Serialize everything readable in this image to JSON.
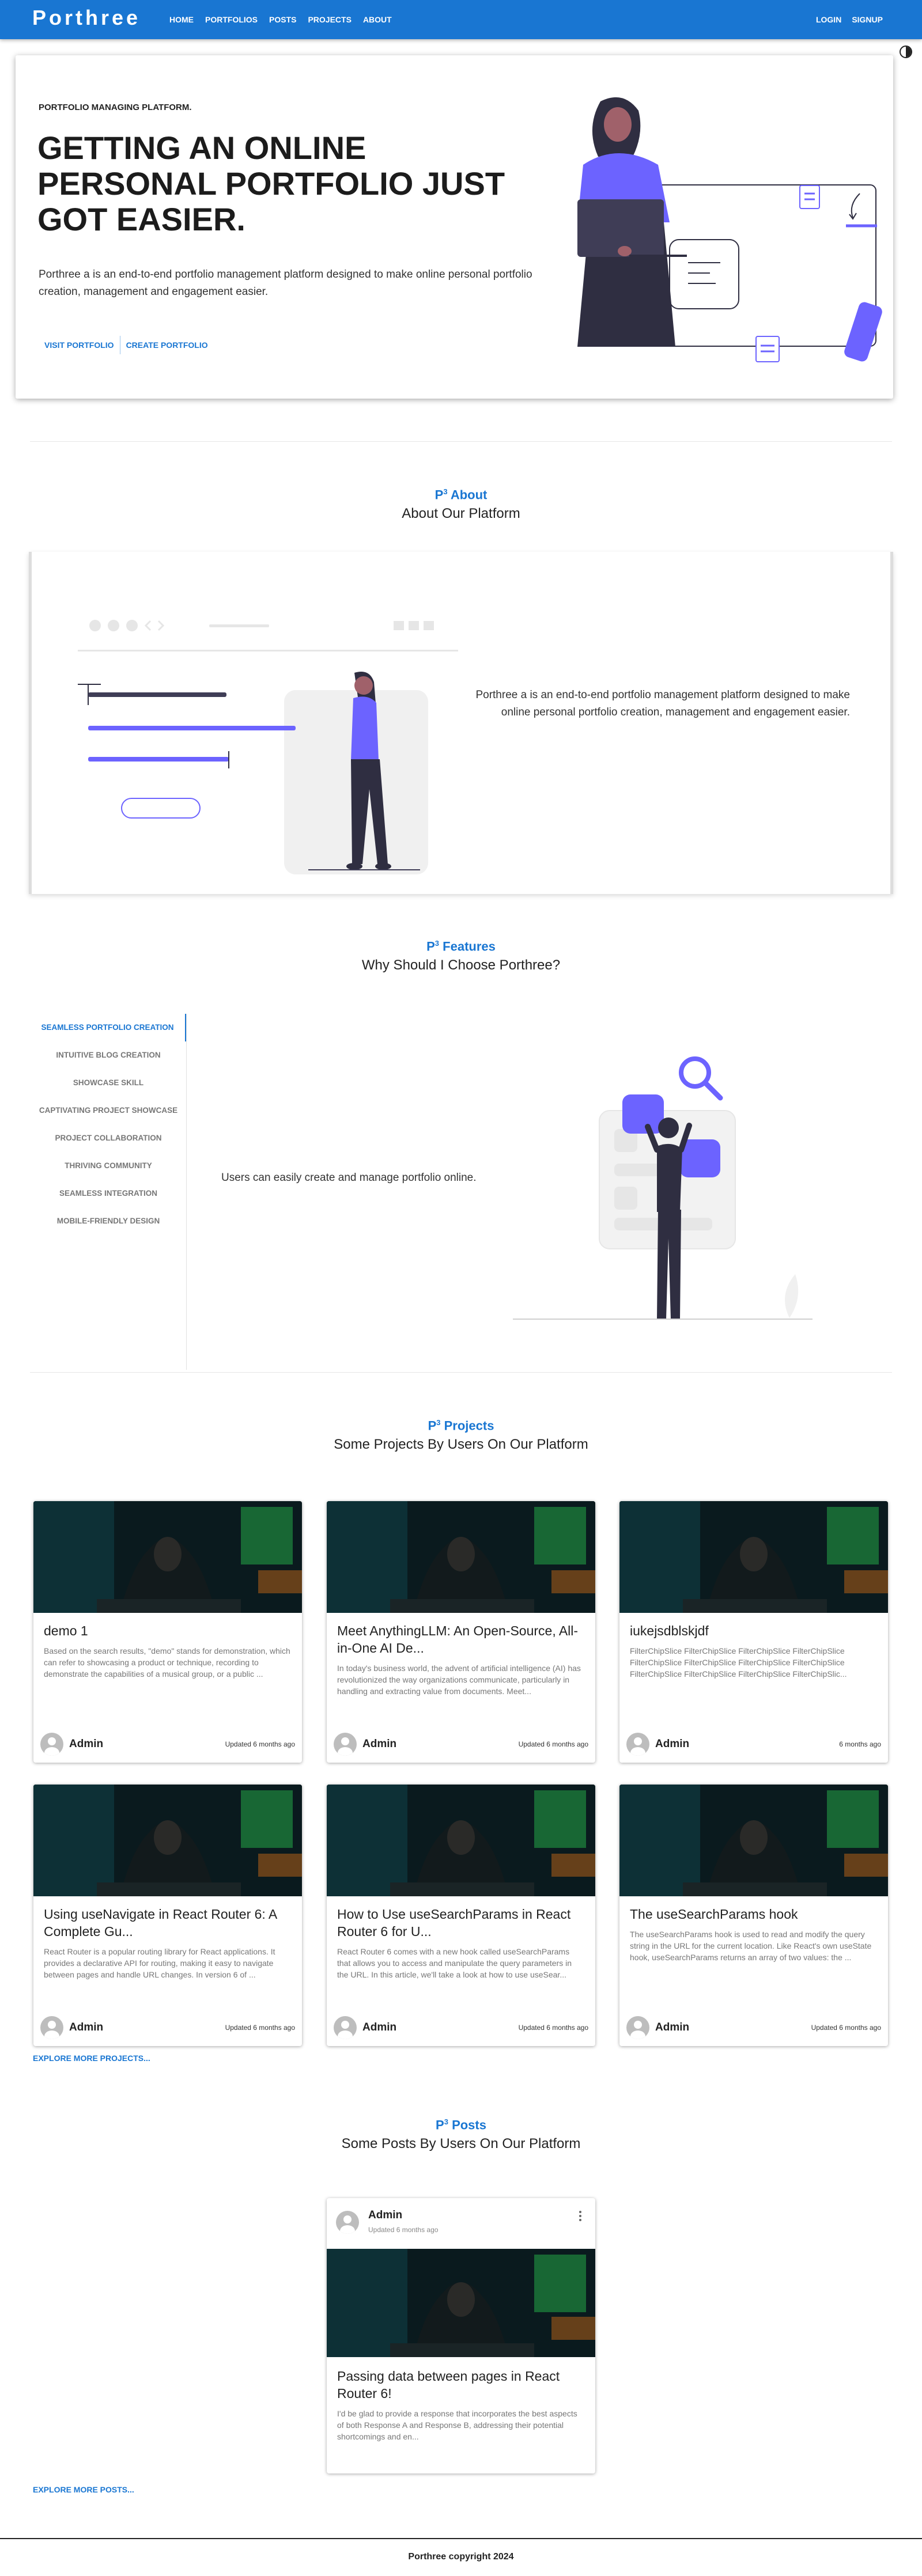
{
  "nav": {
    "brand": "Porthree",
    "links": [
      "HOME",
      "PORTFOLIOS",
      "POSTS",
      "PROJECTS",
      "ABOUT"
    ],
    "right": [
      "LOGIN",
      "SIGNUP"
    ],
    "color": "#1976d2"
  },
  "hero": {
    "kicker": "PORTFOLIO MANAGING PLATFORM.",
    "title": "GETTING AN ONLINE PERSONAL PORTFOLIO JUST GOT EASIER.",
    "description": "Porthree a is an end-to-end portfolio management platform designed to make online personal portfolio creation, management and engagement easier.",
    "buttons": [
      "VISIT PORTFOLIO",
      "CREATE PORTFOLIO"
    ]
  },
  "about": {
    "tag": "About",
    "tag_prefix": "P",
    "tag_sup": "3",
    "subtitle": "About Our Platform",
    "text": "Porthree a is an end-to-end portfolio management platform designed to make online personal portfolio creation, management and engagement easier."
  },
  "features": {
    "tag": "Features",
    "tag_prefix": "P",
    "tag_sup": "3",
    "subtitle": "Why Should I Choose Porthree?",
    "tabs": [
      "SEAMLESS PORTFOLIO CREATION",
      "INTUITIVE BLOG CREATION",
      "SHOWCASE SKILL",
      "CAPTIVATING PROJECT SHOWCASE",
      "PROJECT COLLABORATION",
      "THRIVING COMMUNITY",
      "SEAMLESS INTEGRATION",
      "MOBILE-FRIENDLY DESIGN"
    ],
    "active_tab": 0,
    "active_text": "Users can easily create and manage portfolio online."
  },
  "projects": {
    "tag": "Projects",
    "tag_prefix": "P",
    "tag_sup": "3",
    "subtitle": "Some Projects By Users On Our Platform",
    "cards": [
      {
        "title": "demo 1",
        "excerpt": "Based on the search results, \"demo\" stands for demonstration, which can refer to showcasing a product or technique, recording to demonstrate the capabilities of a musical group, or a public ...",
        "author": "Admin",
        "updated": "Updated 6 months ago"
      },
      {
        "title": "Meet AnythingLLM: An Open-Source, All-in-One AI De...",
        "excerpt": "In today's business world, the advent of artificial intelligence (AI) has revolutionized the way organizations communicate, particularly in handling and extracting value from documents. Meet...",
        "author": "Admin",
        "updated": "Updated 6 months ago"
      },
      {
        "title": "iukejsdblskjdf",
        "excerpt": "FilterChipSlice FilterChipSlice FilterChipSlice FilterChipSlice FilterChipSlice FilterChipSlice FilterChipSlice FilterChipSlice FilterChipSlice FilterChipSlice FilterChipSlice FilterChipSlic...",
        "author": "Admin",
        "updated": "6 months ago"
      },
      {
        "title": "Using useNavigate in React Router 6: A Complete Gu...",
        "excerpt": "React Router is a popular routing library for React applications. It provides a declarative API for routing, making it easy to navigate between pages and handle URL changes. In version 6 of ...",
        "author": "Admin",
        "updated": "Updated 6 months ago"
      },
      {
        "title": "How to Use useSearchParams in React Router 6 for U...",
        "excerpt": "React Router 6 comes with a new hook called useSearchParams that allows you to access and manipulate the query parameters in the URL. In this article, we'll take a look at how to use useSear...",
        "author": "Admin",
        "updated": "Updated 6 months ago"
      },
      {
        "title": "The useSearchParams hook",
        "excerpt": "The useSearchParams hook is used to read and modify the query string in the URL for the current location. Like React's own useState hook, useSearchParams returns an array of two values: the ...",
        "author": "Admin",
        "updated": "Updated 6 months ago"
      }
    ],
    "explore": "EXPLORE MORE PROJECTS..."
  },
  "posts": {
    "tag": "Posts",
    "tag_prefix": "P",
    "tag_sup": "3",
    "subtitle": "Some Posts By Users On Our Platform",
    "post": {
      "author": "Admin",
      "updated": "Updated 6 months ago",
      "title": "Passing data between pages in React Router 6!",
      "excerpt": "I'd be glad to provide a response that incorporates the best aspects of both Response A and Response B, addressing their potential shortcomings and en..."
    },
    "explore": "EXPLORE MORE POSTS..."
  },
  "footer": {
    "text": "Porthree copyright 2024"
  }
}
